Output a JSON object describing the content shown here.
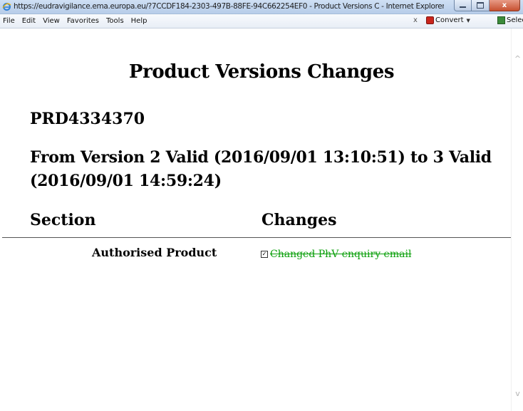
{
  "window": {
    "title": "https://eudravigilance.ema.europa.eu/?7CCDF184-2303-497B-88FE-94C662254EF0 - Product Versions C - Internet Explorer",
    "close_glyph": "x"
  },
  "menu": {
    "items": [
      "File",
      "Edit",
      "View",
      "Favorites",
      "Tools",
      "Help"
    ],
    "close_glyph": "x",
    "convert_label": "Convert",
    "select_label": "Select"
  },
  "page": {
    "title": "Product Versions Changes",
    "product_id": "PRD4334370",
    "version_line": "From Version 2 Valid (2016/09/01 13:10:51) to 3 Valid (2016/09/01 14:59:24)",
    "columns": {
      "section": "Section",
      "changes": "Changes"
    },
    "rows": [
      {
        "section": "Authorised Product",
        "changes": [
          {
            "text": "Changed PhV enquiry email",
            "checked": true,
            "color": "#0a9f0a"
          }
        ]
      }
    ]
  },
  "colors": {
    "change_text": "#0a9f0a"
  }
}
